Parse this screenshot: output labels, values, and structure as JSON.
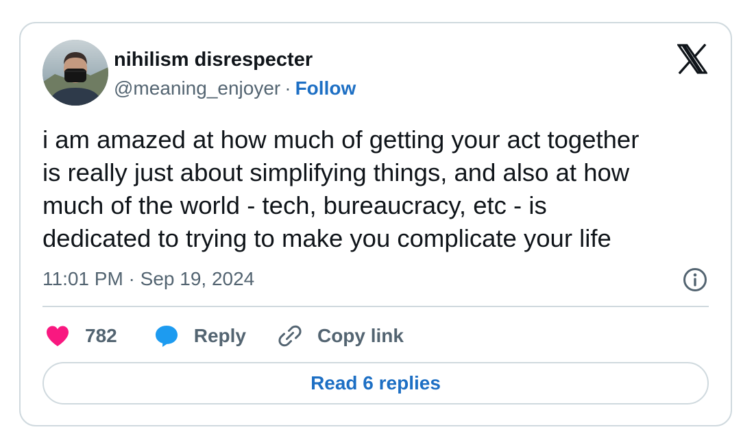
{
  "author": {
    "display_name": "nihilism disrespecter",
    "handle": "@meaning_enjoyer",
    "separator": "·",
    "follow_label": "Follow"
  },
  "platform_icon": "x-logo-icon",
  "tweet": {
    "text_lines": [
      "i am amazed at how much of getting your act together",
      "is really just about simplifying things, and also at how",
      "much of the world - tech, bureaucracy, etc - is",
      "dedicated to trying to make you complicate your life"
    ],
    "timestamp": "11:01 PM · Sep 19, 2024"
  },
  "actions": {
    "like_count": "782",
    "reply_label": "Reply",
    "copy_link_label": "Copy link"
  },
  "read_replies_label": "Read 6 replies",
  "colors": {
    "link_blue": "#1d6fc4",
    "like_pink": "#f91880",
    "reply_blue": "#1d9bf0",
    "secondary_text": "#536471",
    "border": "#cfd9de"
  }
}
